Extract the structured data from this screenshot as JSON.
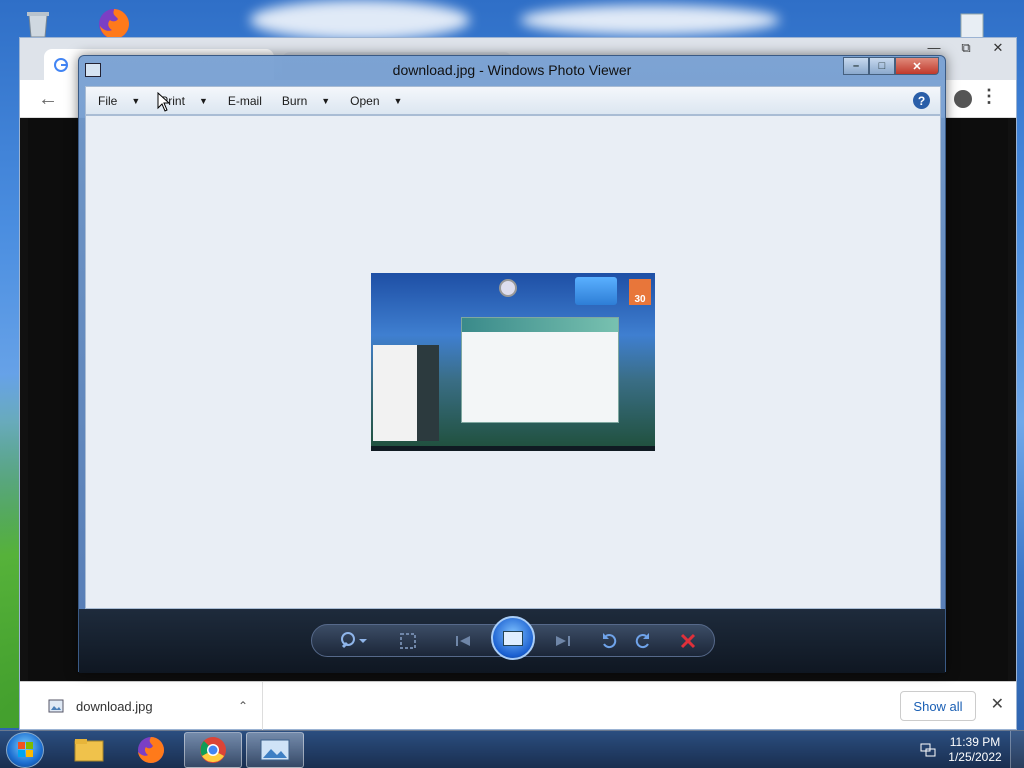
{
  "photo_viewer": {
    "title": "download.jpg - Windows Photo Viewer",
    "menu": [
      {
        "label": "File",
        "has_dropdown": true
      },
      {
        "label": "Print",
        "has_dropdown": true
      },
      {
        "label": "E-mail",
        "has_dropdown": false
      },
      {
        "label": "Burn",
        "has_dropdown": true
      },
      {
        "label": "Open",
        "has_dropdown": true
      }
    ],
    "help_label": "?",
    "image_calendar_day": "30",
    "controls": [
      "zoom-icon",
      "actual-size-icon",
      "previous-icon",
      "slideshow-icon",
      "next-icon",
      "rotate-counterclockwise-icon",
      "rotate-clockwise-icon",
      "delete-icon"
    ]
  },
  "browser": {
    "download_bar": {
      "filename": "download.jpg",
      "show_all_label": "Show all"
    }
  },
  "taskbar": {
    "time": "11:39 PM",
    "date": "1/25/2022",
    "pinned": [
      "windows-explorer-icon",
      "firefox-icon",
      "chrome-icon",
      "photo-viewer-icon"
    ]
  },
  "colors": {
    "accent": "#1a5fb4",
    "close_button": "#c0392b",
    "delete_button": "#e0303a"
  }
}
